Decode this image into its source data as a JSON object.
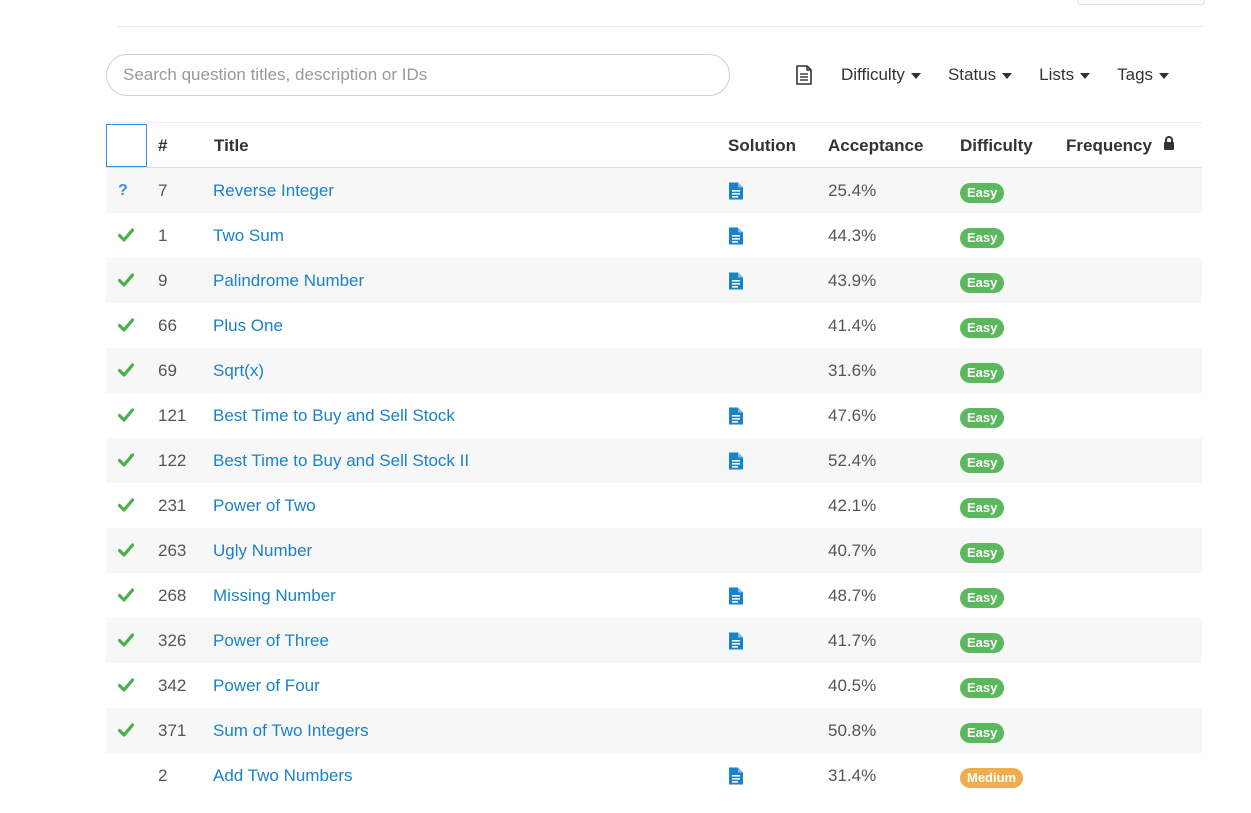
{
  "search": {
    "placeholder": "Search question titles, description or IDs"
  },
  "filters": {
    "difficulty": "Difficulty",
    "status": "Status",
    "lists": "Lists",
    "tags": "Tags"
  },
  "table": {
    "headers": {
      "id": "#",
      "title": "Title",
      "solution": "Solution",
      "acceptance": "Acceptance",
      "difficulty": "Difficulty",
      "frequency": "Frequency"
    },
    "rows": [
      {
        "status": "?",
        "status_icon": "question-mark",
        "id": "7",
        "title": "Reverse Integer",
        "solution": true,
        "acceptance": "25.4%",
        "difficulty": "Easy"
      },
      {
        "status": "ac",
        "status_icon": "check-icon",
        "id": "1",
        "title": "Two Sum",
        "solution": true,
        "acceptance": "44.3%",
        "difficulty": "Easy"
      },
      {
        "status": "ac",
        "status_icon": "check-icon",
        "id": "9",
        "title": "Palindrome Number",
        "solution": true,
        "acceptance": "43.9%",
        "difficulty": "Easy"
      },
      {
        "status": "ac",
        "status_icon": "check-icon",
        "id": "66",
        "title": "Plus One",
        "solution": false,
        "acceptance": "41.4%",
        "difficulty": "Easy"
      },
      {
        "status": "ac",
        "status_icon": "check-icon",
        "id": "69",
        "title": "Sqrt(x)",
        "solution": false,
        "acceptance": "31.6%",
        "difficulty": "Easy"
      },
      {
        "status": "ac",
        "status_icon": "check-icon",
        "id": "121",
        "title": "Best Time to Buy and Sell Stock",
        "solution": true,
        "acceptance": "47.6%",
        "difficulty": "Easy"
      },
      {
        "status": "ac",
        "status_icon": "check-icon",
        "id": "122",
        "title": "Best Time to Buy and Sell Stock II",
        "solution": true,
        "acceptance": "52.4%",
        "difficulty": "Easy"
      },
      {
        "status": "ac",
        "status_icon": "check-icon",
        "id": "231",
        "title": "Power of Two",
        "solution": false,
        "acceptance": "42.1%",
        "difficulty": "Easy"
      },
      {
        "status": "ac",
        "status_icon": "check-icon",
        "id": "263",
        "title": "Ugly Number",
        "solution": false,
        "acceptance": "40.7%",
        "difficulty": "Easy"
      },
      {
        "status": "ac",
        "status_icon": "check-icon",
        "id": "268",
        "title": "Missing Number",
        "solution": true,
        "acceptance": "48.7%",
        "difficulty": "Easy"
      },
      {
        "status": "ac",
        "status_icon": "check-icon",
        "id": "326",
        "title": "Power of Three",
        "solution": true,
        "acceptance": "41.7%",
        "difficulty": "Easy"
      },
      {
        "status": "ac",
        "status_icon": "check-icon",
        "id": "342",
        "title": "Power of Four",
        "solution": false,
        "acceptance": "40.5%",
        "difficulty": "Easy"
      },
      {
        "status": "ac",
        "status_icon": "check-icon",
        "id": "371",
        "title": "Sum of Two Integers",
        "solution": false,
        "acceptance": "50.8%",
        "difficulty": "Easy"
      },
      {
        "status": "",
        "status_icon": "",
        "id": "2",
        "title": "Add Two Numbers",
        "solution": true,
        "acceptance": "31.4%",
        "difficulty": "Medium"
      }
    ]
  },
  "colors": {
    "link": "#1a82c7",
    "easy": "#5cb85c",
    "medium": "#f0ad4e",
    "check": "#4cae4c",
    "solution_icon": "#1a82c7"
  }
}
